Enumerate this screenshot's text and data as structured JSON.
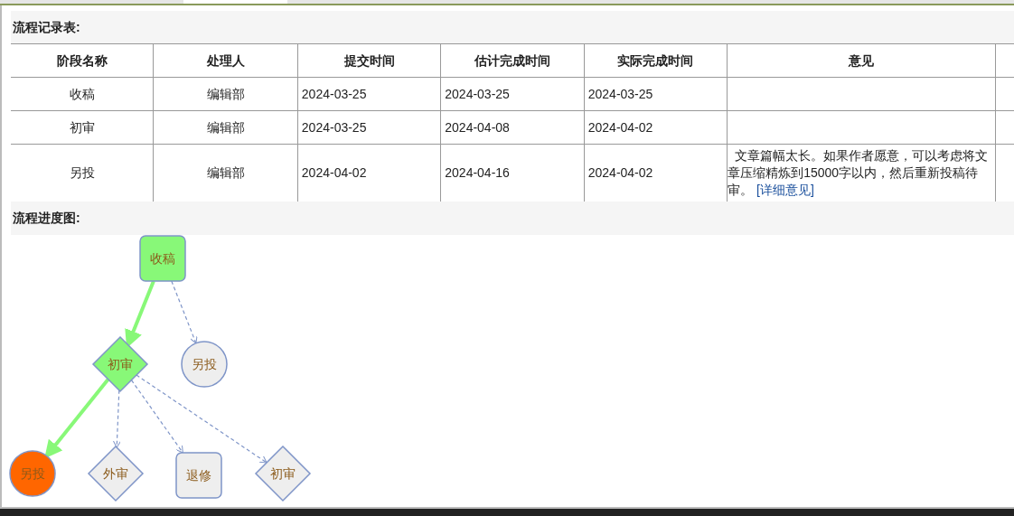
{
  "record_section": {
    "title": "流程记录表:"
  },
  "table": {
    "columns": [
      "阶段名称",
      "处理人",
      "提交时间",
      "估计完成时间",
      "实际完成时间",
      "意见"
    ],
    "rows": [
      {
        "cells": [
          "收稿",
          "编辑部",
          "2024-03-25",
          "2024-03-25",
          "2024-03-25"
        ],
        "opinion": ""
      },
      {
        "cells": [
          "初审",
          "编辑部",
          "2024-03-25",
          "2024-04-08",
          "2024-04-02"
        ],
        "opinion": ""
      },
      {
        "cells": [
          "另投",
          "编辑部",
          "2024-04-02",
          "2024-04-16",
          "2024-04-02"
        ],
        "opinion": "文章篇幅太长。如果作者愿意，可以考虑将文章压缩精炼到15000字以内，然后重新投稿待审。",
        "link": "[详细意见]"
      }
    ]
  },
  "diagram_section": {
    "title": "流程进度图:"
  },
  "diagram": {
    "nodes": [
      {
        "label": "收稿",
        "kind": "rect",
        "color": "#88f878"
      },
      {
        "label": "初审",
        "kind": "diamond",
        "color": "#88f878"
      },
      {
        "label": "另投",
        "kind": "circle",
        "color": "#eeeeee"
      },
      {
        "label": "另投",
        "kind": "circle",
        "color": "#ff6600"
      },
      {
        "label": "外审",
        "kind": "diamond",
        "color": "#eeeeee"
      },
      {
        "label": "退修",
        "kind": "rect",
        "color": "#eeeeee"
      },
      {
        "label": "初审",
        "kind": "diamond",
        "color": "#eeeeee"
      }
    ],
    "edges": [
      {
        "kind": "taken"
      },
      {
        "kind": "option"
      },
      {
        "kind": "taken"
      },
      {
        "kind": "option"
      },
      {
        "kind": "option"
      },
      {
        "kind": "option"
      }
    ]
  }
}
